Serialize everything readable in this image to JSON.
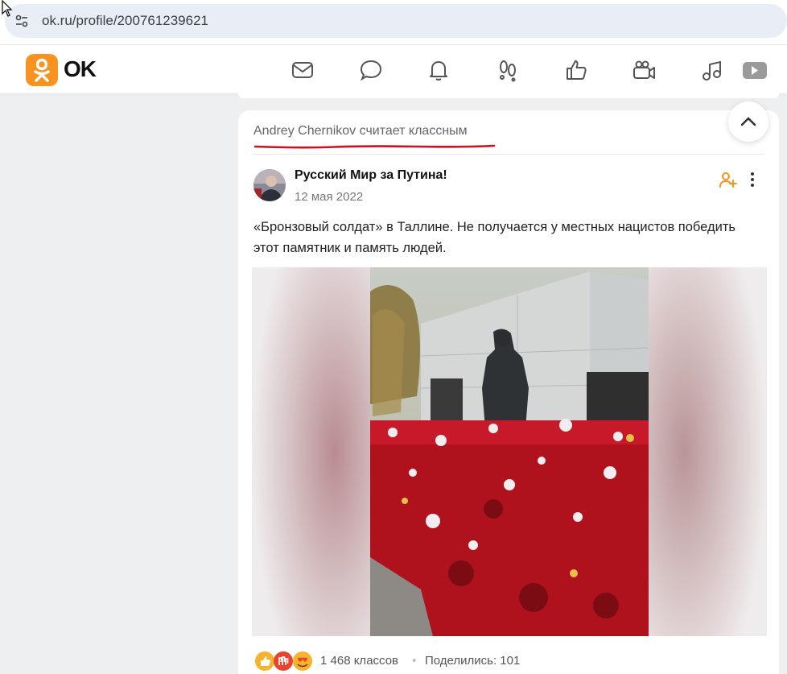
{
  "browser": {
    "url": "ok.ru/profile/200761239621"
  },
  "header": {
    "logo_text": "OK",
    "nav_icons": [
      "mail-icon",
      "chat-icon",
      "bell-icon",
      "guests-icon",
      "like-icon",
      "video-camera-icon",
      "music-icon",
      "video-play-icon"
    ]
  },
  "feed": {
    "activity": "Andrey Chernikov считает классным",
    "post": {
      "author": "Русский Мир за Путина!",
      "date": "12 мая 2022",
      "text": "«Бронзовый солдат» в Таллине. Не получается у местных нацистов победить этот памятник и память людей.",
      "likes": "1 468 классов",
      "separator": "•",
      "shares": "Поделились: 101"
    }
  },
  "colors": {
    "brand": "#f7931e",
    "underline": "#d0101e"
  }
}
